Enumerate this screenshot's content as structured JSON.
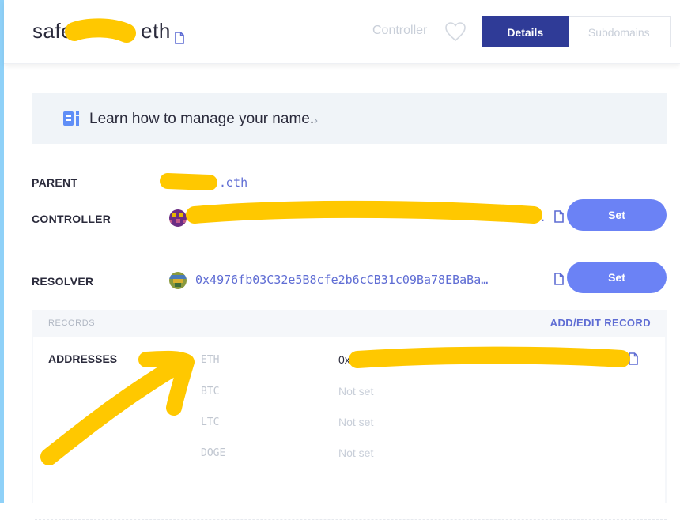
{
  "header": {
    "name_prefix": "safe",
    "name_suffix": "eth",
    "controller_label": "Controller",
    "tabs": {
      "details": "Details",
      "subdomains": "Subdomains"
    }
  },
  "learn": {
    "text": "Learn how to manage your name.",
    "chevron": "›"
  },
  "rows": {
    "parent": {
      "label": "PARENT",
      "value": ".eth"
    },
    "controller": {
      "label": "CONTROLLER",
      "trail": ".",
      "button": "Set"
    },
    "resolver": {
      "label": "RESOLVER",
      "value": "0x4976fb03C32e5B8cfe2b6cCB31c09Ba78EBaBa…",
      "button": "Set"
    }
  },
  "records": {
    "title": "RECORDS",
    "add_edit": "ADD/EDIT RECORD",
    "addresses_label": "ADDRESSES",
    "coins": [
      {
        "coin": "ETH",
        "value": "0x"
      },
      {
        "coin": "BTC",
        "value": "Not set"
      },
      {
        "coin": "LTC",
        "value": "Not set"
      },
      {
        "coin": "DOGE",
        "value": "Not set"
      }
    ]
  },
  "colors": {
    "accent": "#2f3b97",
    "button": "#6b82f5",
    "link": "#5f6dd4",
    "redaction": "#ffc800",
    "leftbar": "#8fd1f8"
  }
}
